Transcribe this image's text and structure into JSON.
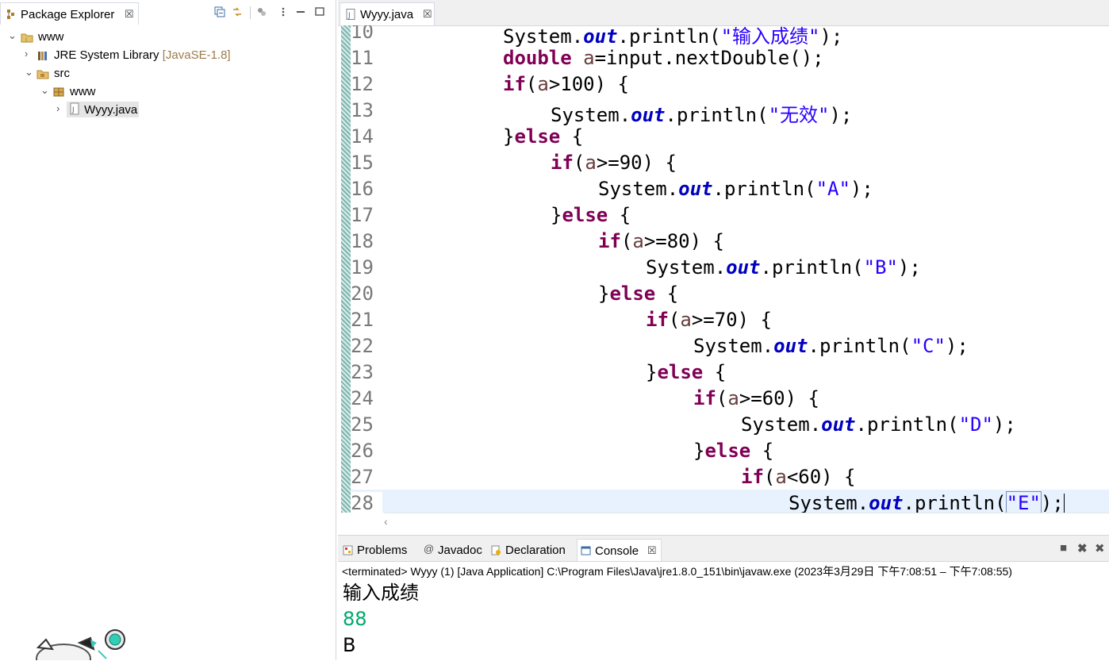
{
  "package_explorer": {
    "title": "Package Explorer",
    "close": "☒",
    "tree": [
      {
        "label": "www",
        "decoration": "",
        "icon": "project-icon"
      },
      {
        "label": "JRE System Library",
        "decoration": "[JavaSE-1.8]",
        "icon": "library-icon"
      },
      {
        "label": "src",
        "decoration": "",
        "icon": "source-folder-icon"
      },
      {
        "label": "www",
        "decoration": "",
        "icon": "package-icon"
      },
      {
        "label": "Wyyy.java",
        "decoration": "",
        "icon": "java-file-icon"
      }
    ]
  },
  "editor": {
    "tab_label": "Wyyy.java",
    "close": "☒",
    "lines": [
      {
        "n": "10"
      },
      {
        "n": "11"
      },
      {
        "n": "12"
      },
      {
        "n": "13"
      },
      {
        "n": "14"
      },
      {
        "n": "15"
      },
      {
        "n": "16"
      },
      {
        "n": "17"
      },
      {
        "n": "18"
      },
      {
        "n": "19"
      },
      {
        "n": "20"
      },
      {
        "n": "21"
      },
      {
        "n": "22"
      },
      {
        "n": "23"
      },
      {
        "n": "24"
      },
      {
        "n": "25"
      },
      {
        "n": "26"
      },
      {
        "n": "27"
      },
      {
        "n": "28"
      }
    ],
    "code": {
      "l10": {
        "a": "System.",
        "b": "out",
        "c": ".println(",
        "d": "\"输入成绩\"",
        "e": ");"
      },
      "l11": {
        "a": "double",
        "b": " ",
        "c": "a",
        "d": "=input.nextDouble();"
      },
      "l12": {
        "a": "if",
        "b": "(",
        "c": "a",
        "d": ">100) {"
      },
      "l13": {
        "a": "System.",
        "b": "out",
        "c": ".println(",
        "d": "\"无效\"",
        "e": ");"
      },
      "l14": {
        "a": "}",
        "b": "else",
        "c": " {"
      },
      "l15": {
        "a": "if",
        "b": "(",
        "c": "a",
        "d": ">=90) {"
      },
      "l16": {
        "a": "System.",
        "b": "out",
        "c": ".println(",
        "d": "\"A\"",
        "e": ");"
      },
      "l17": {
        "a": "}",
        "b": "else",
        "c": " {"
      },
      "l18": {
        "a": "if",
        "b": "(",
        "c": "a",
        "d": ">=80) {"
      },
      "l19": {
        "a": "System.",
        "b": "out",
        "c": ".println(",
        "d": "\"B\"",
        "e": ");"
      },
      "l20": {
        "a": "}",
        "b": "else",
        "c": " {"
      },
      "l21": {
        "a": "if",
        "b": "(",
        "c": "a",
        "d": ">=70) {"
      },
      "l22": {
        "a": "System.",
        "b": "out",
        "c": ".println(",
        "d": "\"C\"",
        "e": ");"
      },
      "l23": {
        "a": "}",
        "b": "else",
        "c": " {"
      },
      "l24": {
        "a": "if",
        "b": "(",
        "c": "a",
        "d": ">=60) {"
      },
      "l25": {
        "a": "System.",
        "b": "out",
        "c": ".println(",
        "d": "\"D\"",
        "e": ");"
      },
      "l26": {
        "a": "}",
        "b": "else",
        "c": " {"
      },
      "l27": {
        "a": "if",
        "b": "(",
        "c": "a",
        "d": "<60) {"
      },
      "l28": {
        "a": "System.",
        "b": "out",
        "c": ".println(",
        "d": "\"E\"",
        "e": ");"
      }
    }
  },
  "bottom_panel": {
    "tabs": [
      {
        "label": "Problems",
        "icon": "problems-icon"
      },
      {
        "label": "Javadoc",
        "icon": "at-icon"
      },
      {
        "label": "Declaration",
        "icon": "declaration-icon"
      },
      {
        "label": "Console",
        "icon": "console-icon"
      }
    ],
    "close": "☒",
    "terminated": "<terminated> Wyyy (1) [Java Application] C:\\Program Files\\Java\\jre1.8.0_151\\bin\\javaw.exe  (2023年3月29日 下午7:08:51 – 下午7:08:55)",
    "output": [
      "输入成绩",
      "88",
      "B"
    ]
  },
  "colors": {
    "keyword": "#7f0055",
    "field": "#0000c0",
    "string": "#2a00ff",
    "stdin": "#00a86b",
    "current_line": "#e8f2fe"
  }
}
